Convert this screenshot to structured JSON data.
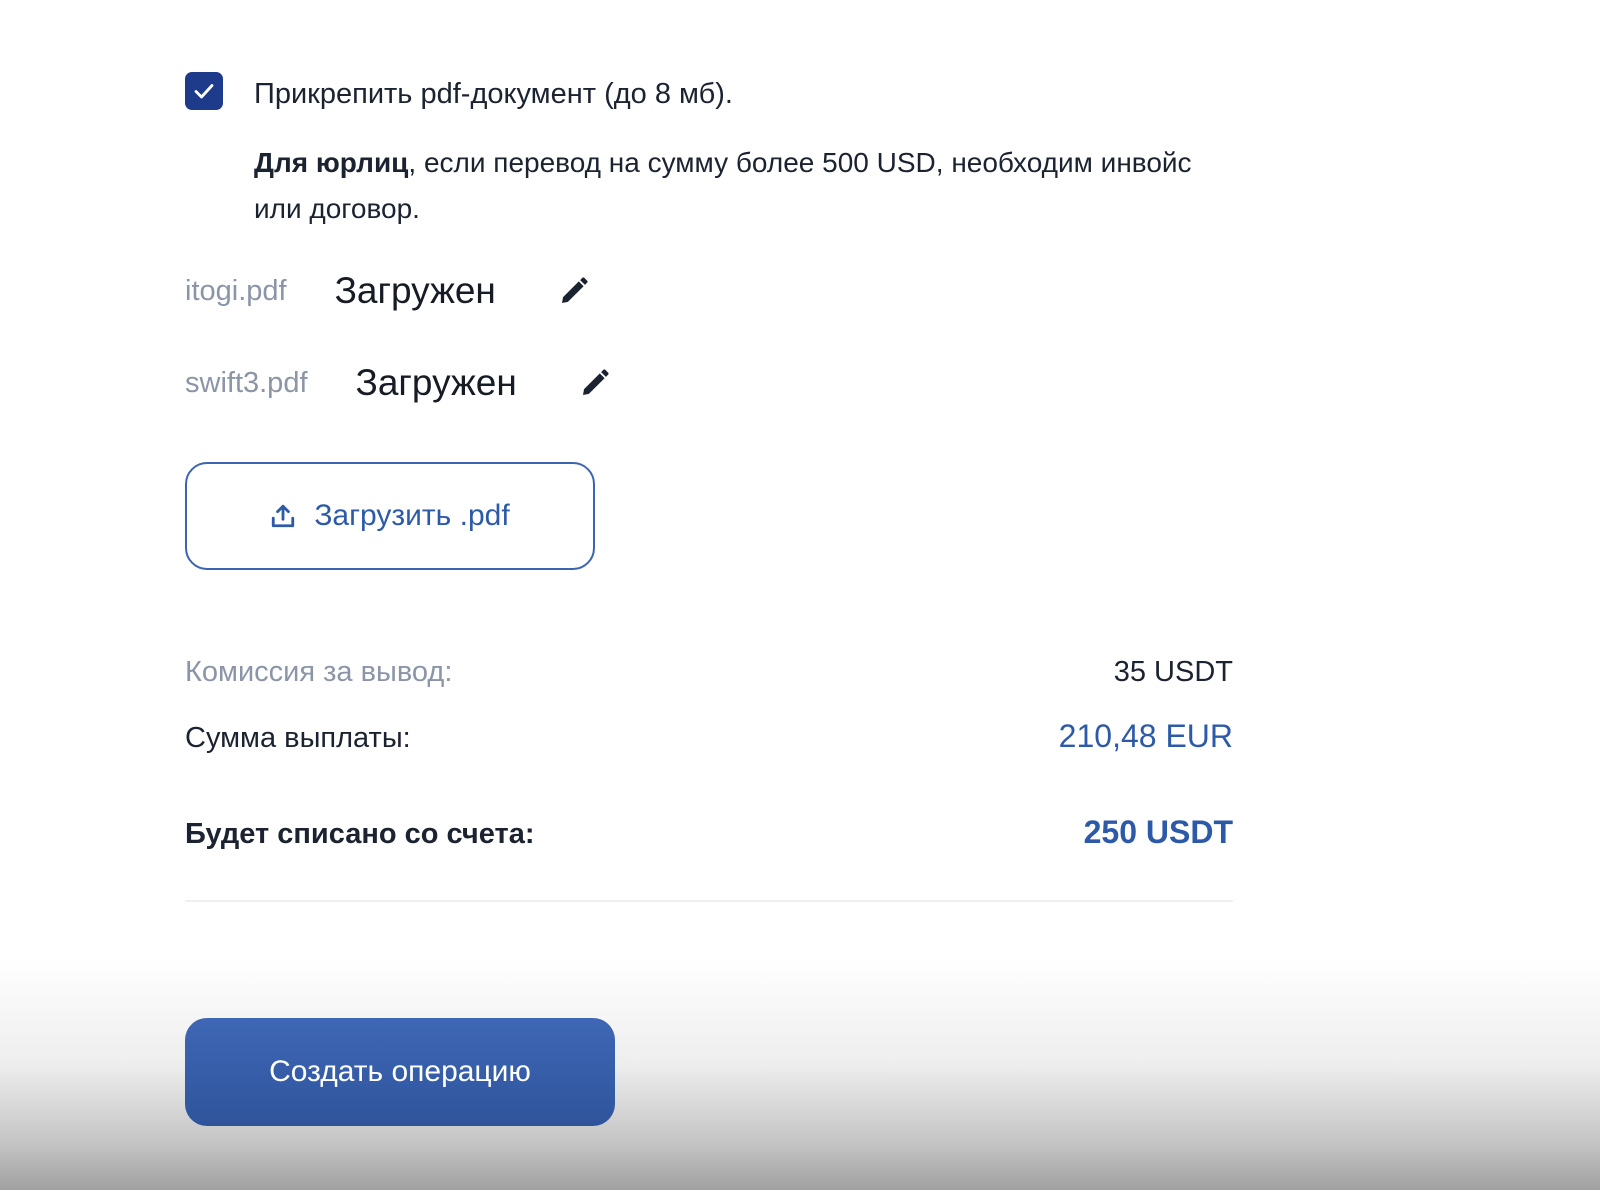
{
  "attachment": {
    "checked": true,
    "label": "Прикрепить pdf-документ (до 8 мб).",
    "note_bold": "Для юрлиц",
    "note_rest": ", если перевод на сумму более 500 USD, необходим инвойс или договор."
  },
  "files": [
    {
      "name": "itogi.pdf",
      "status": "Загружен"
    },
    {
      "name": "swift3.pdf",
      "status": "Загружен"
    }
  ],
  "upload": {
    "label": "Загрузить .pdf"
  },
  "summary": {
    "fee_label": "Комиссия за вывод:",
    "fee_value": "35 USDT",
    "payout_label": "Сумма выплаты:",
    "payout_value": "210,48 EUR",
    "debit_label": "Будет списано со счета:",
    "debit_value": "250 USDT"
  },
  "actions": {
    "create_label": "Создать операцию"
  },
  "colors": {
    "accent": "#2d5aa8",
    "checkbox": "#1e3a8a",
    "muted_text": "#8b95a7",
    "button": "#3a62ae"
  }
}
